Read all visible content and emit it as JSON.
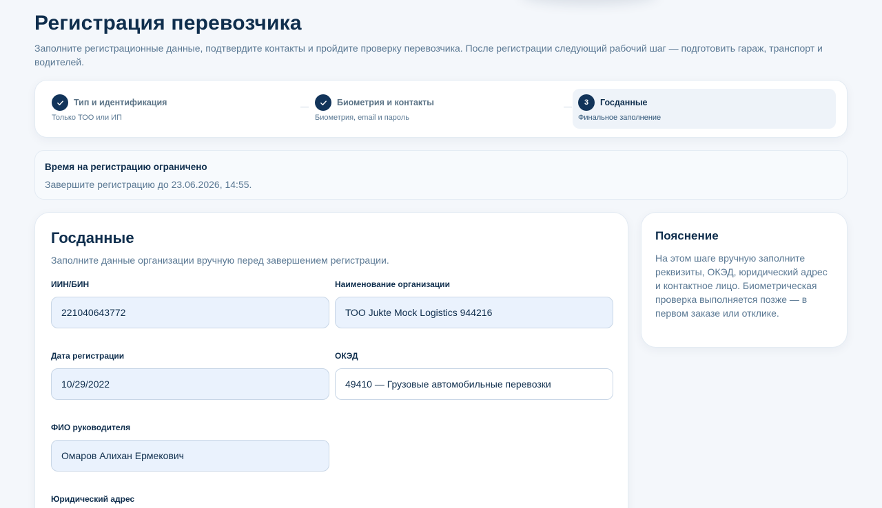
{
  "header": {
    "title": "Регистрация перевозчика",
    "subtitle": "Заполните регистрационные данные, подтвердите контакты и пройдите проверку перевозчика. После регистрации следующий рабочий шаг — подготовить гараж, транспорт и водителей."
  },
  "stepper": {
    "steps": [
      {
        "title": "Тип и идентификация",
        "subtitle": "Только ТОО или ИП",
        "status": "done",
        "icon": "check-icon"
      },
      {
        "title": "Биометрия и контакты",
        "subtitle": "Биометрия, email и пароль",
        "status": "done",
        "icon": "check-icon"
      },
      {
        "number": "3",
        "title": "Госданные",
        "subtitle": "Финальное заполнение",
        "status": "active"
      }
    ]
  },
  "notice": {
    "title": "Время на регистрацию ограничено",
    "text": "Завершите регистрацию до 23.06.2026, 14:55."
  },
  "form": {
    "title": "Госданные",
    "description": "Заполните данные организации вручную перед завершением регистрации.",
    "fields": {
      "iin": {
        "label": "ИИН/БИН",
        "value": "221040643772"
      },
      "org_name": {
        "label": "Наименование организации",
        "value": "ТОО Jukte Mock Logistics 944216"
      },
      "reg_date": {
        "label": "Дата регистрации",
        "value": "10/29/2022"
      },
      "oked": {
        "label": "ОКЭД",
        "value": "49410 — Грузовые автомобильные перевозки"
      },
      "ceo": {
        "label": "ФИО руководителя",
        "value": "Омаров Алихан Ермекович"
      },
      "address": {
        "label": "Юридический адрес",
        "value": ""
      }
    }
  },
  "side": {
    "title": "Пояснение",
    "text": "На этом шаге вручную заполните реквизиты, ОКЭД, юридический адрес и контактное лицо. Биометрическая проверка выполняется позже — в первом заказе или отклике."
  },
  "colors": {
    "primary": "#12345a",
    "text_muted": "#5a7893",
    "input_bg": "#eaf2fd",
    "page_bg": "#f4f7fb"
  }
}
